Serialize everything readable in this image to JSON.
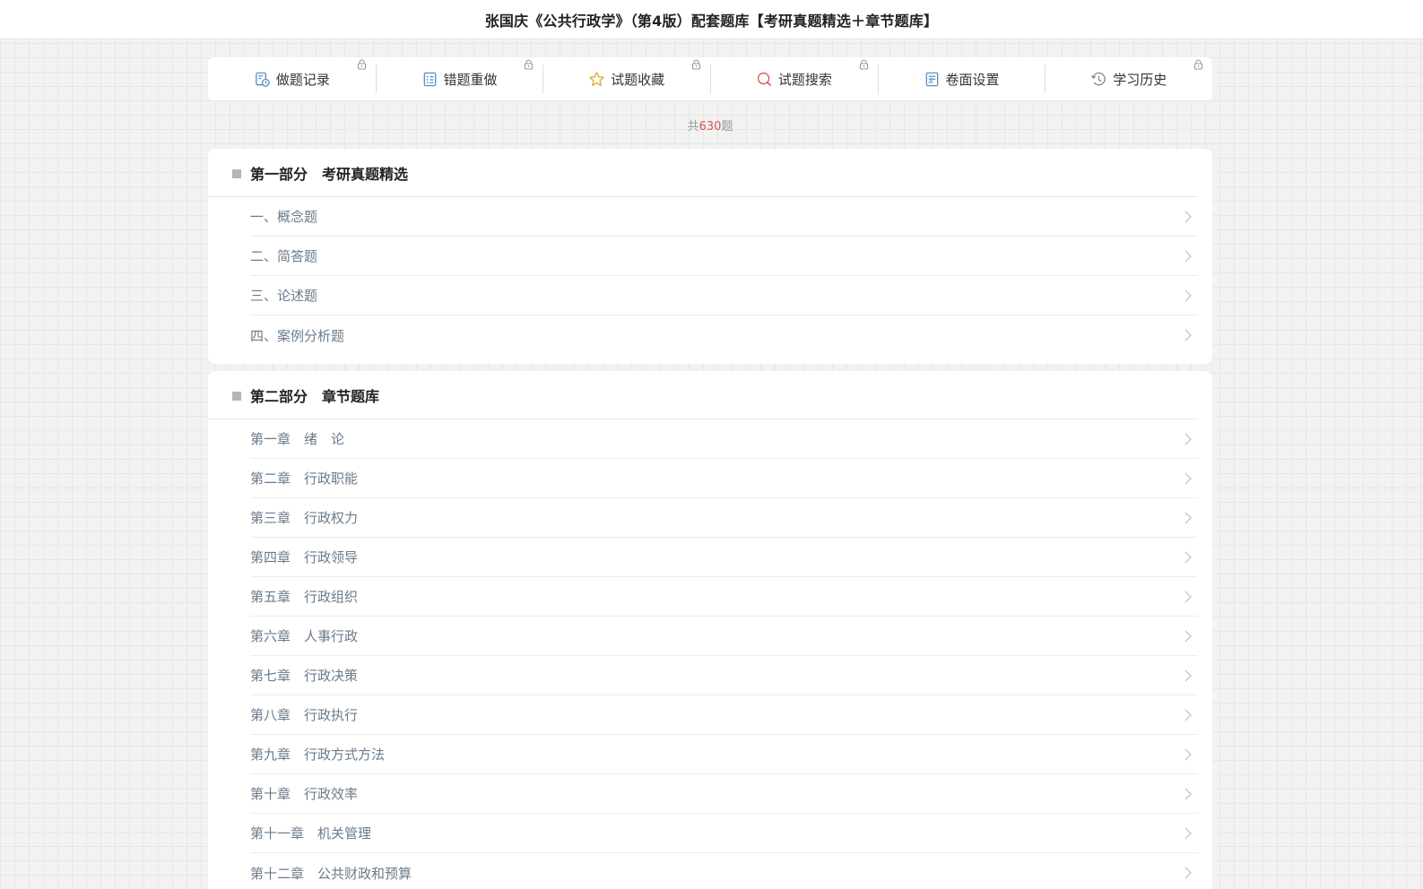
{
  "header": {
    "title": "张国庆《公共行政学》（第4版）配套题库【考研真题精选＋章节题库】"
  },
  "toolbar": {
    "items": [
      {
        "label": "做题记录",
        "icon": "record-icon",
        "locked": true
      },
      {
        "label": "错题重做",
        "icon": "redo-list-icon",
        "locked": true
      },
      {
        "label": "试题收藏",
        "icon": "star-icon",
        "locked": true
      },
      {
        "label": "试题搜索",
        "icon": "search-icon",
        "locked": true
      },
      {
        "label": "卷面设置",
        "icon": "settings-doc-icon",
        "locked": false
      },
      {
        "label": "学习历史",
        "icon": "history-icon",
        "locked": true
      }
    ]
  },
  "summary": {
    "prefix": "共",
    "count": "630",
    "suffix": "题"
  },
  "sections": [
    {
      "title": "第一部分　考研真题精选",
      "items": [
        "一、概念题",
        "二、简答题",
        "三、论述题",
        "四、案例分析题"
      ]
    },
    {
      "title": "第二部分　章节题库",
      "items": [
        "第一章　绪　论",
        "第二章　行政职能",
        "第三章　行政权力",
        "第四章　行政领导",
        "第五章　行政组织",
        "第六章　人事行政",
        "第七章　行政决策",
        "第八章　行政执行",
        "第九章　行政方式方法",
        "第十章　行政效率",
        "第十一章　机关管理",
        "第十二章　公共财政和预算"
      ]
    }
  ],
  "colors": {
    "accent_count": "#d9534f",
    "item_text": "#6a7b8c",
    "icon_blue": "#5b8fc7",
    "icon_star": "#e0a93b",
    "icon_search": "#d9534f"
  }
}
